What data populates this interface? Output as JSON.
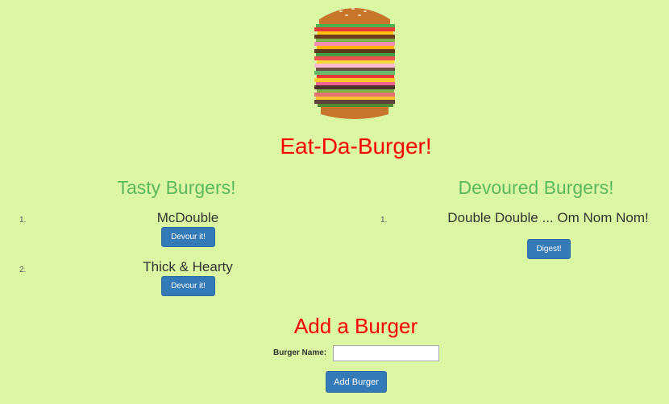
{
  "header": {
    "title": "Eat-Da-Burger!"
  },
  "tasty": {
    "heading": "Tasty Burgers!",
    "items": [
      {
        "num": "1.",
        "name": "McDouble",
        "button": "Devour it!"
      },
      {
        "num": "2.",
        "name": "Thick & Hearty",
        "button": "Devour it!"
      }
    ]
  },
  "devoured": {
    "heading": "Devoured Burgers!",
    "items": [
      {
        "num": "1.",
        "name": "Double Double ... Om Nom Nom!",
        "button": "Digest!"
      }
    ]
  },
  "form": {
    "heading": "Add a Burger",
    "label": "Burger Name:",
    "input_value": "",
    "button": "Add Burger"
  },
  "colors": {
    "background": "#dcf7a4",
    "title_red": "#ff0000",
    "heading_green": "#5cb85c",
    "button_blue": "#337ab7"
  }
}
